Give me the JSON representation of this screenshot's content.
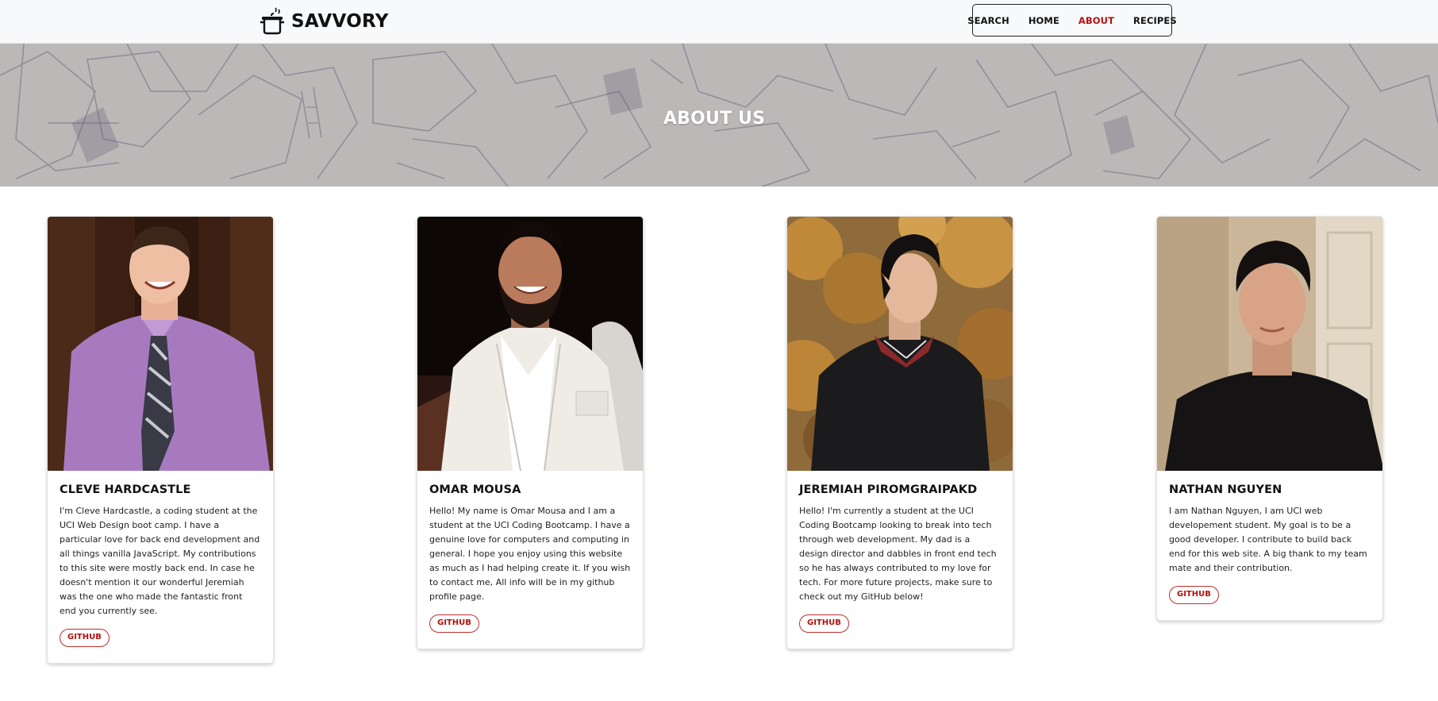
{
  "brand": {
    "name": "SAVVORY",
    "icon": "cooking-pot-icon"
  },
  "nav": {
    "items": [
      {
        "label": "SEARCH",
        "active": false
      },
      {
        "label": "HOME",
        "active": false
      },
      {
        "label": "ABOUT",
        "active": true
      },
      {
        "label": "RECIPES",
        "active": false
      }
    ]
  },
  "hero": {
    "title": "ABOUT US"
  },
  "team": [
    {
      "name": "CLEVE HARDCASTLE",
      "bio": "I'm Cleve Hardcastle, a coding student at the UCI Web Design boot camp. I have a particular love for back end development and all things vanilla JavaScript. My contributions to this site were mostly back end. In case he doesn't mention it our wonderful Jeremiah was the one who made the fantastic front end you currently see.",
      "button": "GITHUB"
    },
    {
      "name": "OMAR MOUSA",
      "bio": "Hello! My name is Omar Mousa and I am a student at the UCI Coding Bootcamp. I have a genuine love for computers and computing in general. I hope you enjoy using this website as much as I had helping create it. If you wish to contact me, All info will be in my github profile page.",
      "button": "GITHUB"
    },
    {
      "name": "JEREMIAH PIROMGRAIPAKD",
      "bio": "Hello! I'm currently a student at the UCI Coding Bootcamp looking to break into tech through web development. My dad is a design director and dabbles in front end tech so he has always contributed to my love for tech. For more future projects, make sure to check out my GitHub below!",
      "button": "GITHUB"
    },
    {
      "name": "NATHAN NGUYEN",
      "bio": "I am Nathan Nguyen, I am UCI web developement student. My goal is to be a good developer. I contribute to build back end for this web site. A big thank to my team mate and their contribution.",
      "button": "GITHUB"
    }
  ],
  "colors": {
    "accent": "#b3110f",
    "navbar_bg": "#f8f9fa",
    "hero_bg": "#b9b6b6"
  }
}
